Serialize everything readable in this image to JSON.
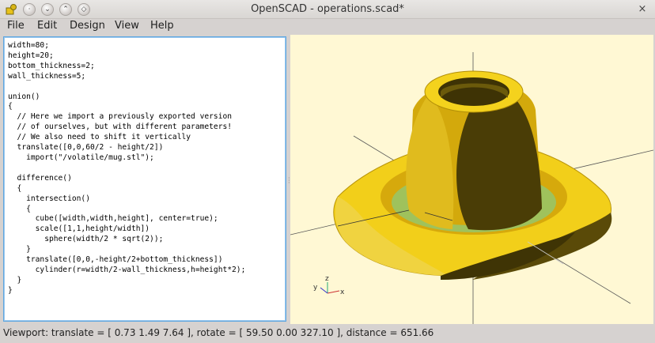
{
  "window": {
    "title": "OpenSCAD - operations.scad*",
    "close_glyph": "×"
  },
  "menu": [
    "File",
    "Edit",
    "Design",
    "View",
    "Help"
  ],
  "editor": {
    "lines": [
      "width=80;",
      "height=20;",
      "bottom_thickness=2;",
      "wall_thickness=5;",
      "",
      "union()",
      "{",
      "  // Here we import a previously exported version",
      "  // of ourselves, but with different parameters!",
      "  // We also need to shift it vertically",
      "  translate([0,0,60/2 - height/2])",
      "    import(\"/volatile/mug.stl\");",
      "",
      "  difference()",
      "  {",
      "    intersection()",
      "    {",
      "      cube([width,width,height], center=true);",
      "      scale([1,1,height/width])",
      "        sphere(width/2 * sqrt(2));",
      "    }",
      "    translate([0,0,-height/2+bottom_thickness])",
      "      cylinder(r=width/2-wall_thickness,h=height*2);",
      "  }",
      "}"
    ]
  },
  "viewport": {
    "background": "#fff8d4",
    "object_color": "#f2cf1a",
    "axis_labels": {
      "x": "x",
      "y": "y",
      "z": "z"
    }
  },
  "status": {
    "text": "Viewport: translate = [ 0.73 1.49 7.64 ], rotate = [ 59.50 0.00 327.10 ], distance = 651.66"
  }
}
